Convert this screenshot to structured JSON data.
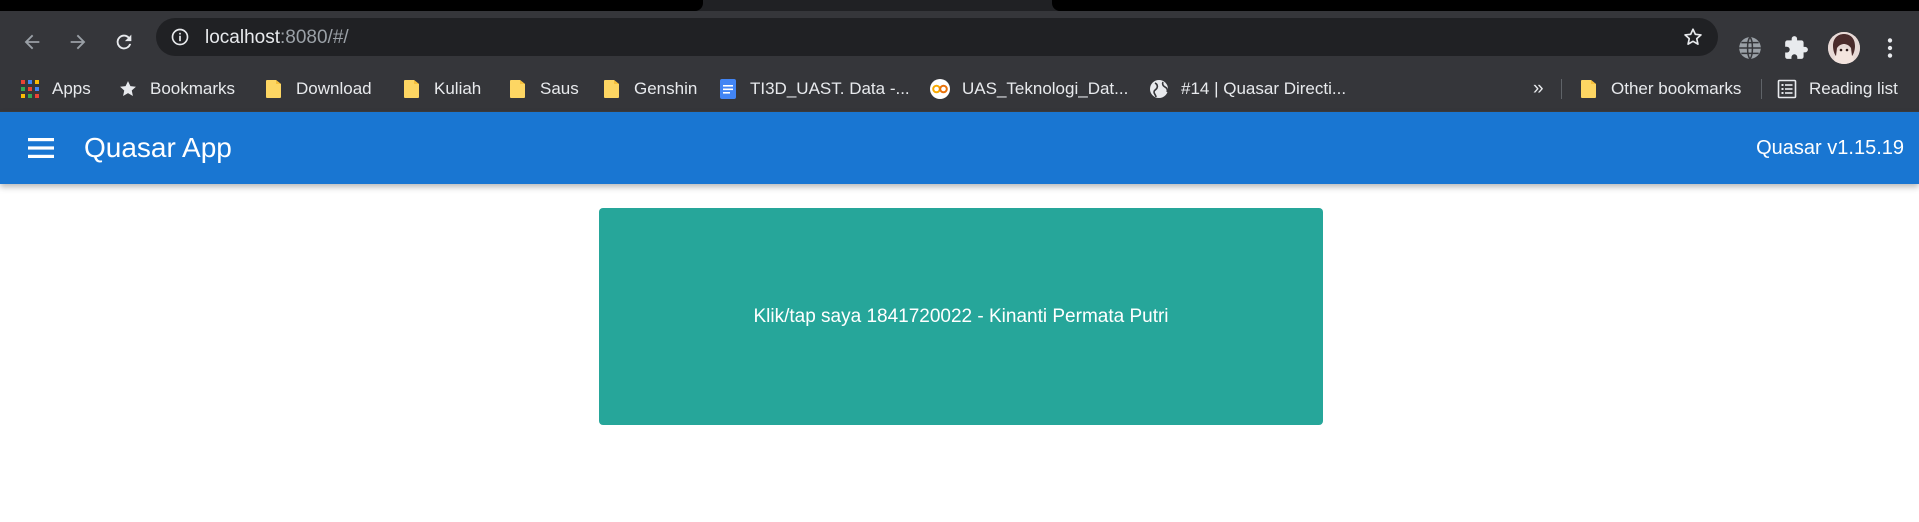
{
  "browser": {
    "url_host": "localhost",
    "url_rest": ":8080/#/",
    "bookmarks": [
      {
        "label": "Apps",
        "icon": "apps-grid-icon"
      },
      {
        "label": "Bookmarks",
        "icon": "star-filled-icon"
      },
      {
        "label": "Download",
        "icon": "folder-icon"
      },
      {
        "label": "Kuliah",
        "icon": "folder-icon"
      },
      {
        "label": "Saus",
        "icon": "folder-icon"
      },
      {
        "label": "Genshin",
        "icon": "folder-icon"
      },
      {
        "label": "TI3D_UAST. Data -...",
        "icon": "google-docs-icon"
      },
      {
        "label": "UAS_Teknologi_Dat...",
        "icon": "colab-icon"
      },
      {
        "label": "#14 | Quasar Directi...",
        "icon": "globe-icon"
      }
    ],
    "overflow": "»",
    "other_bookmarks": "Other bookmarks",
    "reading_list": "Reading list"
  },
  "app": {
    "title": "Quasar App",
    "version": "Quasar v1.15.19"
  },
  "main": {
    "card_text": "Klik/tap saya 1841720022 - Kinanti Permata Putri"
  },
  "colors": {
    "header": "#1976d2",
    "card": "#26a69a",
    "browser_chrome": "#35363a"
  }
}
